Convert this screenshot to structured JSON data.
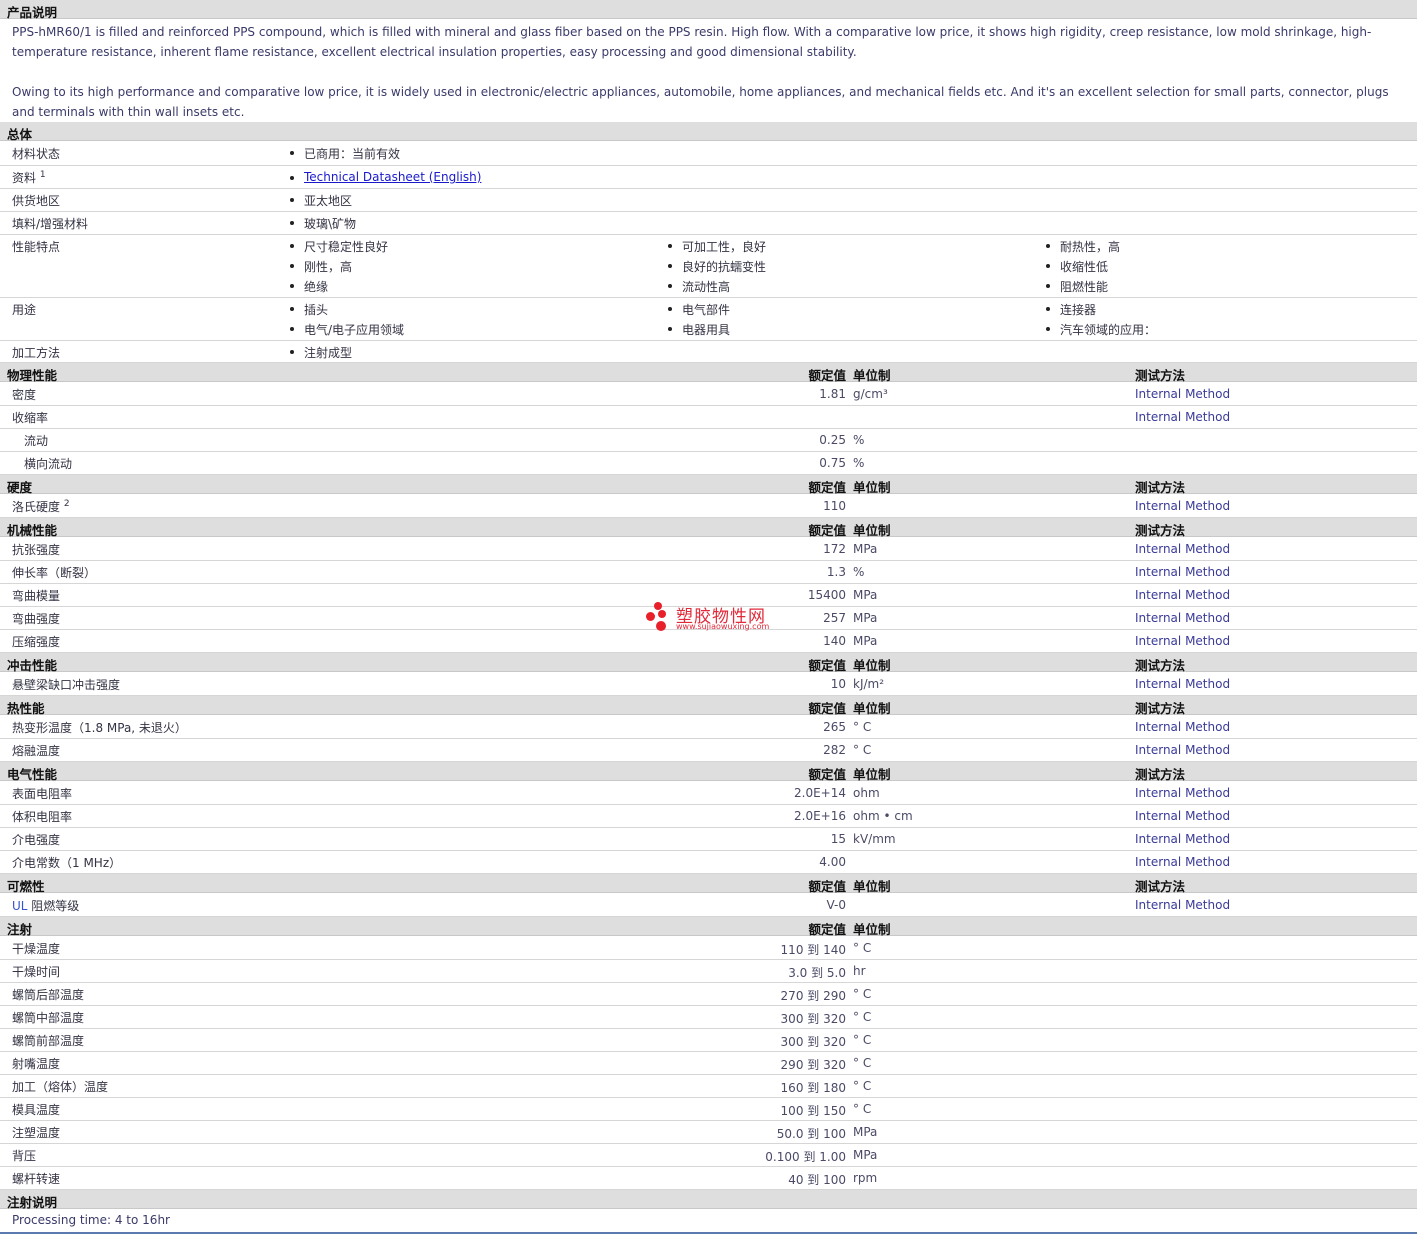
{
  "desc": {
    "header": "产品说明",
    "p1": "PPS-hMR60/1 is filled and reinforced PPS compound, which is filled with mineral and glass fiber based on the PPS resin. High flow. With a comparative low price, it shows high rigidity, creep resistance, low mold shrinkage, high-temperature resistance, inherent flame resistance, excellent electrical insulation properties, easy processing and good dimensional stability.",
    "p2": "Owing to its high performance and comparative low price, it is widely used in electronic/electric appliances, automobile, home appliances, and mechanical fields etc. And it's an excellent selection for small parts, connector, plugs and terminals with thin wall insets etc."
  },
  "general": {
    "header": "总体",
    "status_label": "材料状态",
    "status_value": "已商用：当前有效",
    "doc_label": "资料",
    "doc_sup": "1",
    "doc_link": "Technical Datasheet (English)",
    "region_label": "供货地区",
    "region_value": "亚太地区",
    "filler_label": "填料/增强材料",
    "filler_value": "玻璃\\矿物",
    "features_label": "性能特点",
    "features": [
      "尺寸稳定性良好",
      "可加工性，良好",
      "耐热性，高",
      "刚性，高",
      "良好的抗蠕变性",
      "收缩性低",
      "绝缘",
      "流动性高",
      "阻燃性能"
    ],
    "uses_label": "用途",
    "uses": [
      "插头",
      "电气部件",
      "连接器",
      "电气/电子应用领域",
      "电器用具",
      "汽车领域的应用："
    ],
    "method_label": "加工方法",
    "method_value": "注射成型"
  },
  "cols": {
    "value": "额定值",
    "unit": "单位制",
    "method": "测试方法"
  },
  "physical": {
    "header": "物理性能",
    "rows": [
      {
        "label": "密度",
        "value": "1.81",
        "unit": "g/cm³",
        "method": "Internal Method"
      },
      {
        "label": "收缩率",
        "value": "",
        "unit": "",
        "method": "Internal Method"
      },
      {
        "label": "流动",
        "value": "0.25",
        "unit": "%",
        "method": ""
      },
      {
        "label": "横向流动",
        "value": "0.75",
        "unit": "%",
        "method": ""
      }
    ]
  },
  "hardness": {
    "header": "硬度",
    "rows": [
      {
        "label": "洛氏硬度",
        "sup": "2",
        "value": "110",
        "unit": "",
        "method": "Internal Method"
      }
    ]
  },
  "mechanical": {
    "header": "机械性能",
    "rows": [
      {
        "label": "抗张强度",
        "value": "172",
        "unit": "MPa",
        "method": "Internal Method"
      },
      {
        "label": "伸长率（断裂）",
        "value": "1.3",
        "unit": "%",
        "method": "Internal Method"
      },
      {
        "label": "弯曲模量",
        "value": "15400",
        "unit": "MPa",
        "method": "Internal Method"
      },
      {
        "label": "弯曲强度",
        "value": "257",
        "unit": "MPa",
        "method": "Internal Method"
      },
      {
        "label": "压缩强度",
        "value": "140",
        "unit": "MPa",
        "method": "Internal Method"
      }
    ]
  },
  "impact": {
    "header": "冲击性能",
    "rows": [
      {
        "label": "悬壁梁缺口冲击强度",
        "value": "10",
        "unit": "kJ/m²",
        "method": "Internal Method"
      }
    ]
  },
  "thermal": {
    "header": "热性能",
    "rows": [
      {
        "label": "热变形温度（1.8 MPa, 未退火）",
        "value": "265",
        "unit": "° C",
        "method": "Internal Method"
      },
      {
        "label": "熔融温度",
        "value": "282",
        "unit": "° C",
        "method": "Internal Method"
      }
    ]
  },
  "electrical": {
    "header": "电气性能",
    "rows": [
      {
        "label": "表面电阻率",
        "value": "2.0E+14",
        "unit": "ohm",
        "method": "Internal Method"
      },
      {
        "label": "体积电阻率",
        "value": "2.0E+16",
        "unit": "ohm • cm",
        "method": "Internal Method"
      },
      {
        "label": "介电强度",
        "value": "15",
        "unit": "kV/mm",
        "method": "Internal Method"
      },
      {
        "label": "介电常数（1 MHz）",
        "value": "4.00",
        "unit": "",
        "method": "Internal Method"
      }
    ]
  },
  "flammability": {
    "header": "可燃性",
    "ul": "UL",
    "label": "阻燃等级",
    "value": "V-0",
    "method": "Internal Method"
  },
  "injection": {
    "header": "注射",
    "rows": [
      {
        "label": "干燥温度",
        "value": "110 到  140",
        "unit": "° C"
      },
      {
        "label": "干燥时间",
        "value": "3.0 到  5.0",
        "unit": "hr"
      },
      {
        "label": "螺筒后部温度",
        "value": "270 到  290",
        "unit": "° C"
      },
      {
        "label": "螺筒中部温度",
        "value": "300 到  320",
        "unit": "° C"
      },
      {
        "label": "螺筒前部温度",
        "value": "300 到  320",
        "unit": "° C"
      },
      {
        "label": "射嘴温度",
        "value": "290 到  320",
        "unit": "° C"
      },
      {
        "label": "加工（熔体）温度",
        "value": "160 到  180",
        "unit": "° C"
      },
      {
        "label": "模具温度",
        "value": "100 到  150",
        "unit": "° C"
      },
      {
        "label": "注塑温度",
        "value": "50.0 到  100",
        "unit": "MPa"
      },
      {
        "label": "背压",
        "value": "0.100 到  1.00",
        "unit": "MPa"
      },
      {
        "label": "螺杆转速",
        "value": "40 到  100",
        "unit": "rpm"
      }
    ]
  },
  "injection_notes": {
    "header": "注射说明",
    "text": "Processing time: 4 to 16hr"
  },
  "watermark": {
    "text": "塑胶物性网",
    "url": "www.sujiaowuxing.com",
    "color": "#e02a3a"
  }
}
